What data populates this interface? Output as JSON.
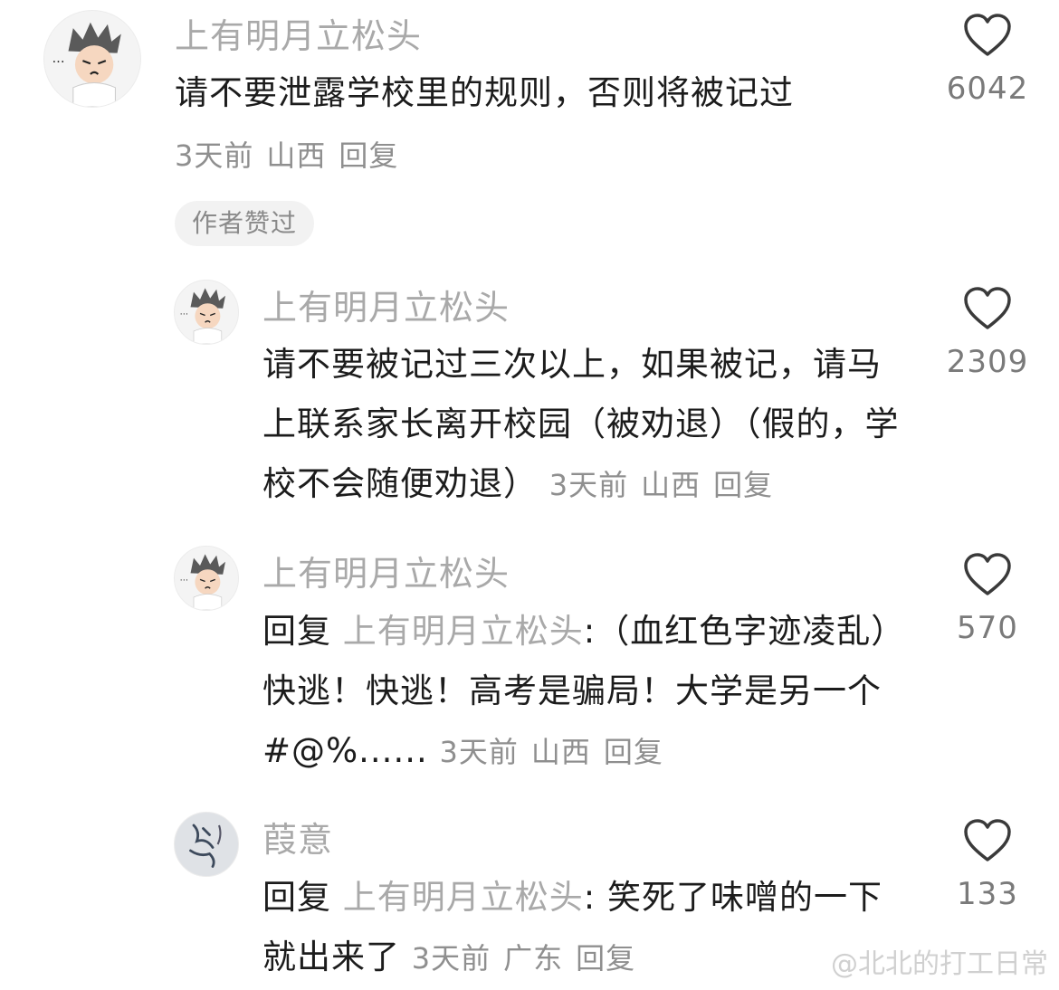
{
  "comments": [
    {
      "username": "上有明月立松头",
      "text": "请不要泄露学校里的规则，否则将被记过",
      "meta": {
        "time": "3天前",
        "location": "山西",
        "reply_label": "回复"
      },
      "likes": "6042",
      "badge": "作者赞过",
      "avatar_icon": "cartoon-character-avatar"
    },
    {
      "username": "上有明月立松头",
      "text": "请不要被记过三次以上，如果被记，请马上联系家长离开校园（被劝退）（假的，学校不会随便劝退）",
      "meta": {
        "time": "3天前",
        "location": "山西",
        "reply_label": "回复"
      },
      "likes": "2309",
      "avatar_icon": "cartoon-character-avatar"
    },
    {
      "username": "上有明月立松头",
      "reply_prefix": "回复",
      "reply_to": "上有明月立松头",
      "text": ":（血红色字迹凌乱）快逃！快逃！高考是骗局！大学是另一个#@%......",
      "meta": {
        "time": "3天前",
        "location": "山西",
        "reply_label": "回复"
      },
      "likes": "570",
      "avatar_icon": "cartoon-character-avatar"
    },
    {
      "username": "葭意",
      "reply_prefix": "回复",
      "reply_to": "上有明月立松头",
      "text": ": 笑死了味噌的一下就出来了",
      "meta": {
        "time": "3天前",
        "location": "广东",
        "reply_label": "回复"
      },
      "likes": "133",
      "avatar_icon": "calligraphy-avatar"
    }
  ],
  "watermark": "@北北的打工日常",
  "colors": {
    "username": "#a9a9a9",
    "text": "#1c1c1c",
    "meta": "#8f8f8f",
    "heart": "#3a3a3a",
    "badge_bg": "#f2f2f2"
  }
}
